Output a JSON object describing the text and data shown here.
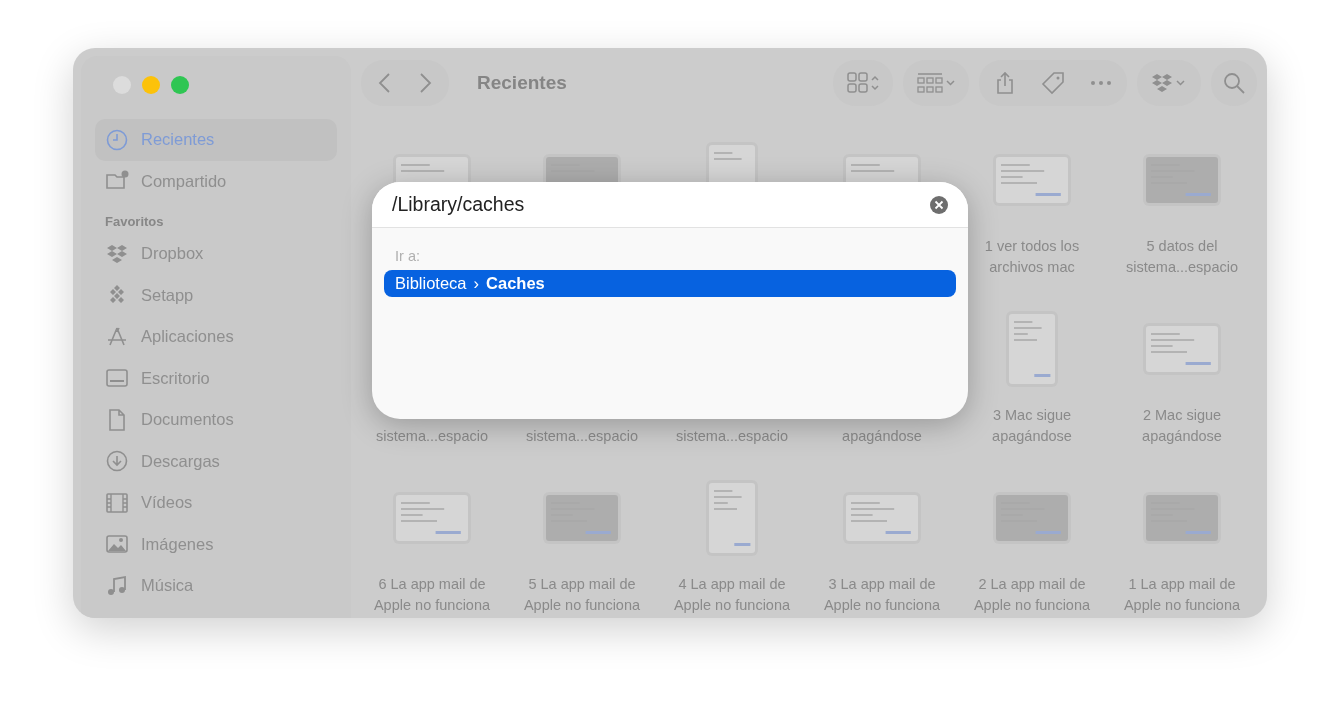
{
  "window": {
    "title": "Recientes"
  },
  "sidebar": {
    "locations": [
      {
        "label": "Recientes",
        "kind": "clock",
        "selected": true
      },
      {
        "label": "Compartido",
        "kind": "shared",
        "selected": false
      }
    ],
    "favorites": {
      "title": "Favoritos",
      "items": [
        {
          "label": "Dropbox",
          "kind": "dropbox",
          "selected": false
        },
        {
          "label": "Setapp",
          "kind": "setapp",
          "selected": false
        },
        {
          "label": "Aplicaciones",
          "kind": "apps",
          "selected": false
        },
        {
          "label": "Escritorio",
          "kind": "desktop",
          "selected": false
        },
        {
          "label": "Documentos",
          "kind": "document",
          "selected": false
        },
        {
          "label": "Descargas",
          "kind": "download",
          "selected": false
        },
        {
          "label": "Vídeos",
          "kind": "film",
          "selected": false
        },
        {
          "label": "Imágenes",
          "kind": "image",
          "selected": false
        },
        {
          "label": "Música",
          "kind": "music",
          "selected": false
        }
      ]
    }
  },
  "files": [
    {
      "kind": "file"
    },
    {
      "kind": "file"
    },
    {
      "kind": "file"
    },
    {
      "kind": "file"
    },
    {
      "label_lines": [
        "1 ver todos los",
        "archivos mac"
      ]
    },
    {
      "label_lines": [
        "5 datos del",
        "sistema...espacio"
      ]
    },
    {
      "kind": "label_only",
      "label_lines": [
        "sistema...espacio"
      ]
    },
    {
      "kind": "label_only",
      "label_lines": [
        "sistema...espacio"
      ]
    },
    {
      "kind": "label_only",
      "label_lines": [
        "sistema...espacio"
      ]
    },
    {
      "kind": "label_only",
      "label_lines": [
        "apagándose"
      ]
    },
    {
      "label_lines": [
        "3 Mac sigue",
        "apagándose"
      ]
    },
    {
      "label_lines": [
        "2 Mac sigue",
        "apagándose"
      ]
    },
    {
      "label_lines": [
        "6 La app mail de",
        "Apple no funciona"
      ]
    },
    {
      "label_lines": [
        "5 La app mail de",
        "Apple no funciona"
      ]
    },
    {
      "label_lines": [
        "4 La app mail de",
        "Apple no funciona"
      ]
    },
    {
      "label_lines": [
        "3 La app mail de",
        "Apple no funciona"
      ]
    },
    {
      "label_lines": [
        "2 La app mail de",
        "Apple no funciona"
      ]
    },
    {
      "label_lines": [
        "1 La app mail de",
        "Apple no funciona"
      ]
    }
  ],
  "go_to_dialog": {
    "path_field": {
      "value": "/Library/caches"
    },
    "results_label": "Ir a:",
    "results": [
      {
        "parts": [
          "Biblioteca",
          "Caches"
        ],
        "separator": "›",
        "selected": true
      }
    ]
  }
}
